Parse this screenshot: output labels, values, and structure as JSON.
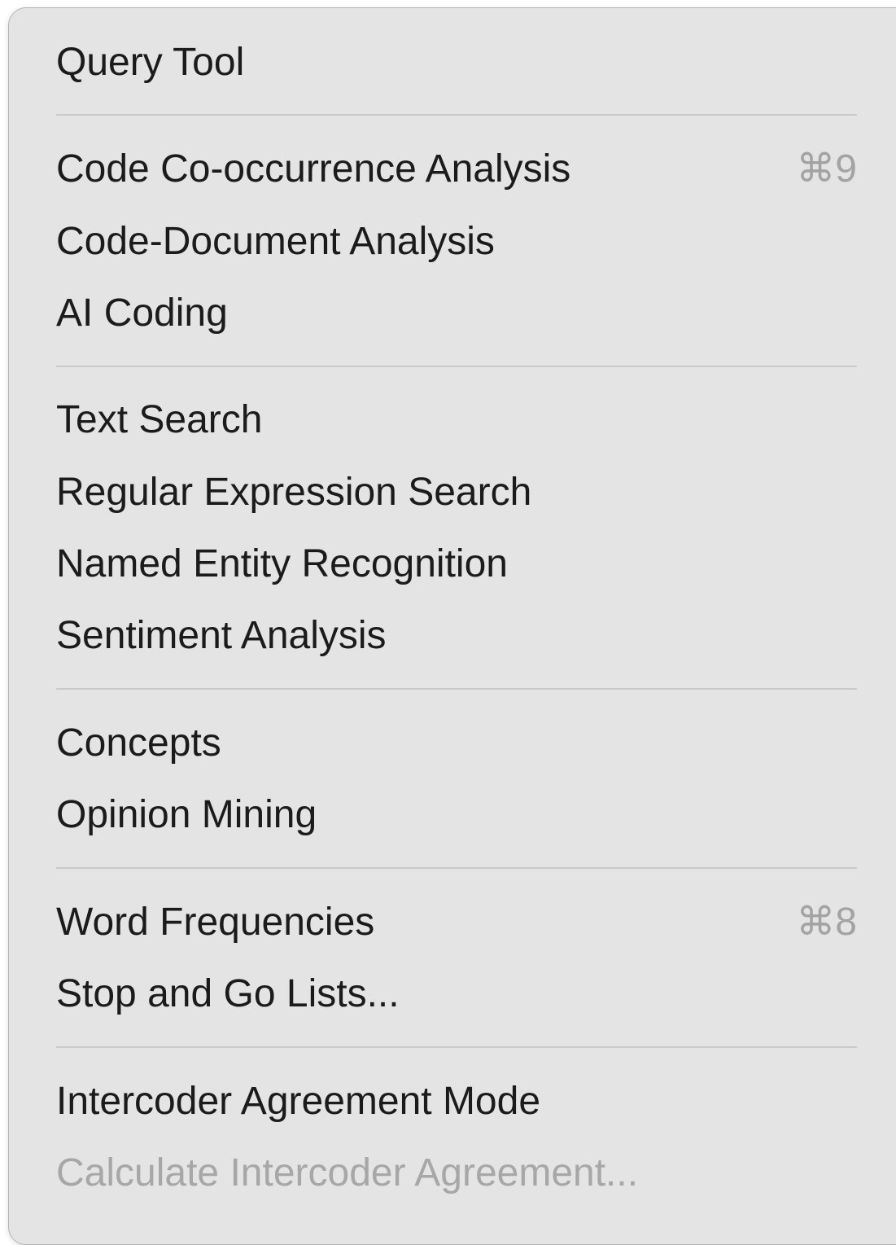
{
  "menu": {
    "items": [
      {
        "label": "Query Tool"
      },
      {
        "label": "Code Co-occurrence Analysis",
        "shortcut": "⌘9"
      },
      {
        "label": "Code-Document Analysis"
      },
      {
        "label": "AI Coding"
      },
      {
        "label": "Text Search"
      },
      {
        "label": "Regular Expression Search"
      },
      {
        "label": "Named Entity Recognition"
      },
      {
        "label": "Sentiment Analysis"
      },
      {
        "label": "Concepts"
      },
      {
        "label": "Opinion Mining"
      },
      {
        "label": "Word Frequencies",
        "shortcut": "⌘8"
      },
      {
        "label": "Stop and Go Lists..."
      },
      {
        "label": "Intercoder Agreement Mode"
      },
      {
        "label": "Calculate Intercoder Agreement...",
        "state": "disabled"
      }
    ]
  }
}
